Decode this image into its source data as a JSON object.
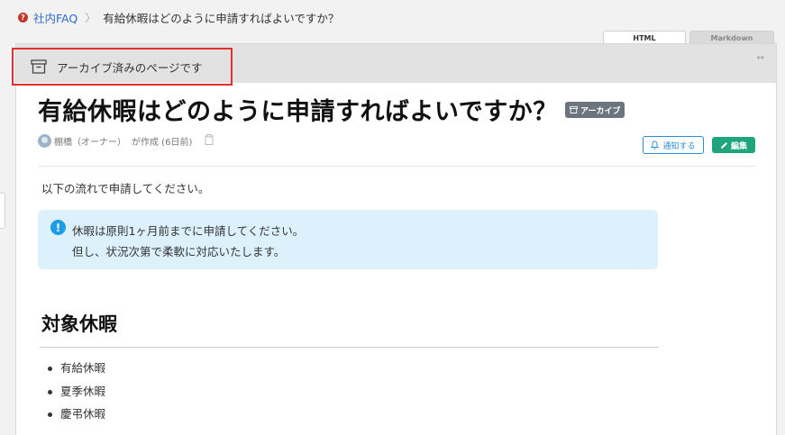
{
  "breadcrumb": {
    "icon": "question-circle-icon",
    "icon_glyph": "?",
    "root": "社内FAQ",
    "separator": "〉",
    "current": "有給休暇はどのように申請すればよいですか？"
  },
  "view_tabs": [
    {
      "label": "HTML",
      "active": true
    },
    {
      "label": "Markdown",
      "active": false
    }
  ],
  "archive_banner": {
    "icon": "archive-box-icon",
    "text": "アーカイブ済みのページです",
    "expand_icon": "expand-arrows-icon",
    "expand_glyph": "↔"
  },
  "page": {
    "title": "有給休暇はどのように申請すればよいですか？",
    "badge": "アーカイブ",
    "author": "棚橋（オーナー）",
    "created_text": "が作成 (6日前)",
    "notify_button": "通知する",
    "edit_button": "編集"
  },
  "content": {
    "intro": "以下の流れで申請してください。",
    "info_lines": [
      "休暇は原則1ヶ月前までに申請してください。",
      "但し、状況次第で柔軟に対応いたします。"
    ],
    "section_heading": "対象休暇",
    "leave_types": [
      "有給休暇",
      "夏季休暇",
      "慶弔休暇"
    ]
  },
  "colors": {
    "link": "#2a6cc8",
    "notify": "#2a8bd8",
    "edit": "#20a47b",
    "info_bg": "#dcf1fc",
    "highlight": "#e03131"
  }
}
